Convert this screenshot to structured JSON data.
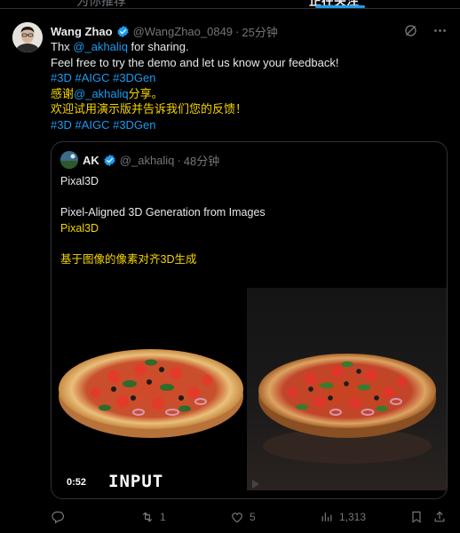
{
  "tabs": [
    {
      "label": "为你推荐",
      "active": false
    },
    {
      "label": "正在关注",
      "active": true
    }
  ],
  "accent": "#1d9bf0",
  "tweet": {
    "author": "Wang Zhao",
    "handle": "@WangZhao_0849",
    "time": "25分钟",
    "line1_prefix": "Thx ",
    "line1_mention": "@_akhaliq",
    "line1_suffix": " for sharing.",
    "line2": "Feel free to try the demo and let us know your feedback!",
    "line3": "#3D #AIGC #3DGen",
    "line4_prefix": "感谢",
    "line4_mention": "@_akhaliq",
    "line4_suffix": "分享。",
    "line5": "欢迎试用演示版并告诉我们您的反馈！",
    "line6": "#3D #AIGC #3DGen"
  },
  "quoted": {
    "author": "AK",
    "handle": "@_akhaliq",
    "time": "48分钟",
    "line1": "Pixal3D",
    "line2": "Pixel-Aligned 3D Generation from Images",
    "line3": "Pixal3D",
    "line4": "基于图像的像素对齐3D生成",
    "video_time": "0:52",
    "watermark": "INPUT"
  },
  "actions": {
    "reply_count": "",
    "retweet_count": "1",
    "like_count": "5",
    "views_count": "1,313"
  }
}
